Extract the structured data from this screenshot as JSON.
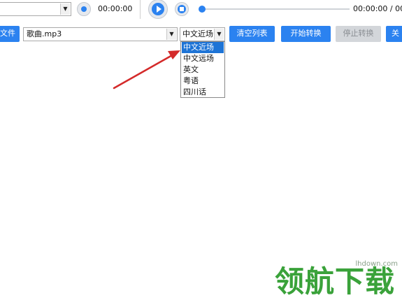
{
  "top_bar": {
    "time_left": "00:00:00",
    "time_right": "00:00:00 / 00:"
  },
  "toolbar": {
    "add_file_label": "文件",
    "file_select_value": "歌曲.mp3",
    "mode_select_value": "中文近场",
    "clear_list_label": "清空列表",
    "start_convert_label": "开始转换",
    "stop_convert_label": "停止转换",
    "close_label": "关"
  },
  "dropdown": {
    "options": [
      "中文近场",
      "中文远场",
      "英文",
      "粤语",
      "四川话"
    ],
    "selected_index": 0
  },
  "watermark": {
    "text": "领航下载",
    "url": "lhdown.com"
  },
  "colors": {
    "accent": "#2b82f0",
    "highlight": "#1e74d6",
    "arrow": "#d42a2a",
    "watermark": "#3aa23a"
  }
}
